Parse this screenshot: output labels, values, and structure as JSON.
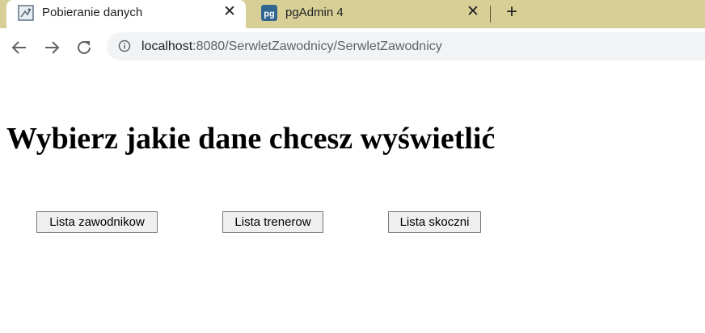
{
  "browser": {
    "tabs": [
      {
        "title": "Pobieranie danych",
        "active": true,
        "icon": "page-favicon-icon"
      },
      {
        "title": "pgAdmin 4",
        "active": false,
        "icon": "pgadmin-icon"
      }
    ],
    "new_tab_icon": "plus-icon",
    "close_icon": "close-icon",
    "address": {
      "host": "localhost",
      "path": ":8080/SerwletZawodnicy/SerwletZawodnicy"
    },
    "colors": {
      "tabstrip": "#d7cf95",
      "pgadmin_brand": "#326690"
    }
  },
  "page": {
    "heading": "Wybierz jakie dane chcesz wyświetlić",
    "buttons": [
      {
        "label": "Lista zawodnikow"
      },
      {
        "label": "Lista trenerow"
      },
      {
        "label": "Lista skoczni"
      }
    ]
  }
}
